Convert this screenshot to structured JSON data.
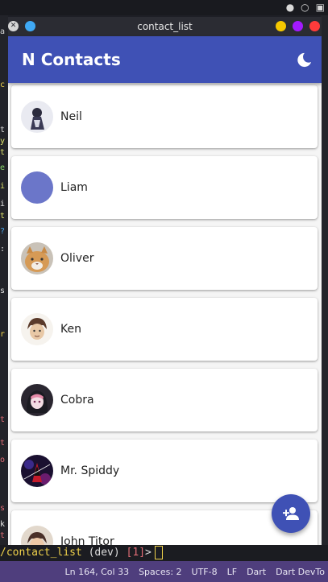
{
  "window": {
    "title": "contact_list"
  },
  "appbar": {
    "title": "N Contacts",
    "theme_toggle_icon": "moon-icon"
  },
  "contacts": [
    {
      "name": "Neil",
      "avatar": "photo"
    },
    {
      "name": "Liam",
      "avatar": "placeholder",
      "avatar_color": "#6b76c9"
    },
    {
      "name": "Oliver",
      "avatar": "photo"
    },
    {
      "name": "Ken",
      "avatar": "photo"
    },
    {
      "name": "Cobra",
      "avatar": "photo"
    },
    {
      "name": "Mr. Spiddy",
      "avatar": "photo"
    },
    {
      "name": "John Titor",
      "avatar": "photo"
    }
  ],
  "fab": {
    "icon": "person-add-icon"
  },
  "terminal": {
    "path": "/contact_list",
    "branch": " (dev) ",
    "count": "[1]",
    "prompt": ">"
  },
  "statusbar": {
    "position": "Ln 164, Col 33",
    "spaces": "Spaces: 2",
    "encoding": "UTF-8",
    "eol": "LF",
    "language": "Dart",
    "devtools": "Dart DevTo"
  },
  "colors": {
    "primary": "#3f51b5",
    "statusbar": "#4f3e7d",
    "background": "#f5f5f5"
  }
}
